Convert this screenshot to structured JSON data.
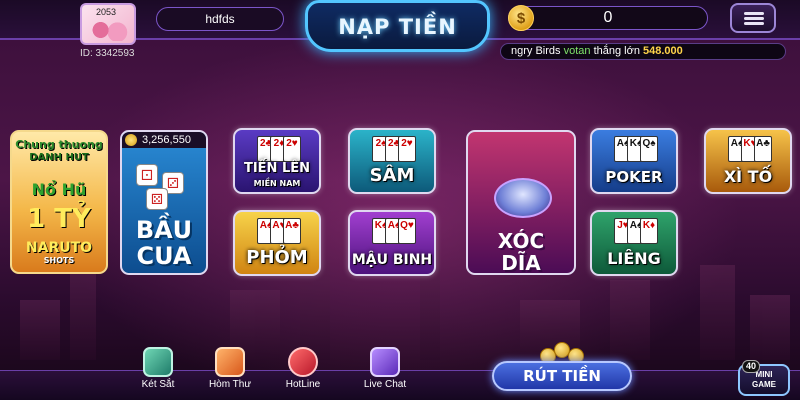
{
  "header": {
    "avatar_level": "2053",
    "user_id": "ID: 3342593",
    "username": "hdfds",
    "deposit_label": "NẠP TIỀN",
    "balance": "0",
    "coin_icon": "dollar-coin-icon",
    "menu_icon": "hamburger-menu-icon"
  },
  "ticker": {
    "prefix": "ngry Birds",
    "player": "votan",
    "action": "thắng lớn",
    "amount": "548.000"
  },
  "banner": {
    "line1": "Chung thuong",
    "line2": "DANH HUT",
    "line3": "Nổ Hũ",
    "line4": "1 TỶ",
    "line5": "NARUTO",
    "line6": "SHOTS"
  },
  "games": {
    "baucua": {
      "pot": "3,256,550",
      "label_1": "BẦU",
      "label_2": "CUA"
    },
    "tienlen": {
      "label": "TIẾN LÊN",
      "sub": "MIỀN NAM"
    },
    "sam": {
      "label": "SÂM"
    },
    "phom": {
      "label": "PHỎM"
    },
    "maubinh": {
      "label": "MẬU BINH"
    },
    "xocdia": {
      "label_1": "XÓC",
      "label_2": "DĨA"
    },
    "poker": {
      "label": "POKER"
    },
    "xito": {
      "label": "XÌ TỐ"
    },
    "lieng": {
      "label": "LIÊNG"
    }
  },
  "bottom": {
    "items": [
      {
        "label": "Két Sắt",
        "icon": "safe-icon"
      },
      {
        "label": "Hòm Thư",
        "icon": "mailbox-icon"
      },
      {
        "label": "HotLine",
        "icon": "telephone-icon"
      },
      {
        "label": "Live Chat",
        "icon": "chat-bubble-icon"
      }
    ],
    "withdraw_label": "RÚT TIỀN",
    "minigame_count": "40",
    "minigame_line1": "MINI",
    "minigame_line2": "GAME"
  },
  "colors": {
    "accent_blue": "#53c6ff",
    "background_purple": "#4c1547",
    "ticker_user": "#7ee36a",
    "ticker_amount": "#ffd54a"
  }
}
